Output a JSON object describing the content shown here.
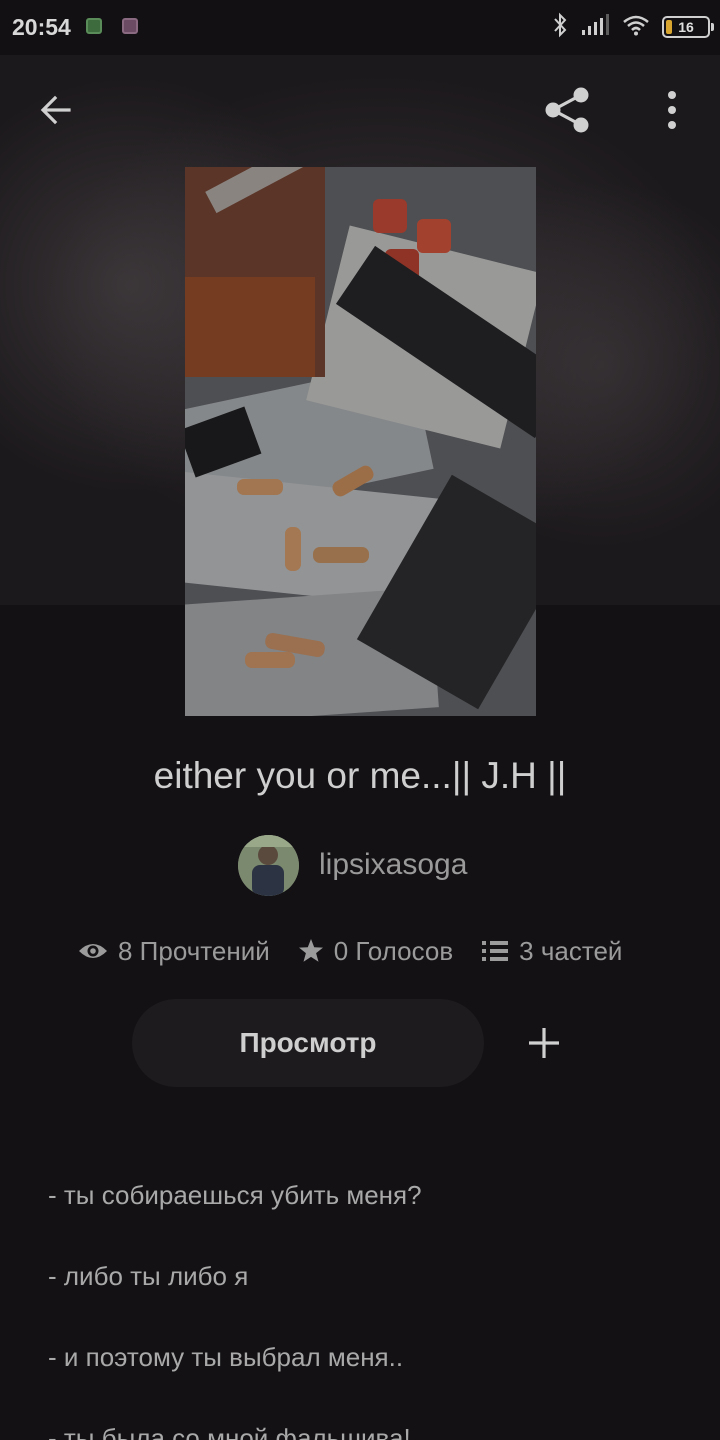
{
  "status_bar": {
    "time": "20:54",
    "battery": "16",
    "icons": [
      "notification-green-icon",
      "notification-purple-icon",
      "bluetooth-icon",
      "signal-icon",
      "wifi-icon",
      "battery-icon"
    ]
  },
  "toolbar": {
    "back_icon": "arrow-left-icon",
    "share_icon": "share-icon",
    "more_icon": "more-vertical-icon"
  },
  "story": {
    "title": "either you or me...|| J.H ||",
    "author": "lipsixasoga",
    "stats": {
      "reads": "8 Прочтений",
      "votes": "0 Голосов",
      "parts": "3 частей"
    },
    "read_button": "Просмотр",
    "add_icon": "plus-icon",
    "description": [
      "- ты собираешься убить меня?",
      "- либо ты либо я",
      "- и поэтому ты выбрал меня..",
      "- ты была со мной фальшива!"
    ]
  },
  "colors": {
    "background": "#131114",
    "text_primary": "#cfcfcf",
    "text_secondary": "#9b9b9b",
    "button_bg": "#1d1b1e",
    "battery_low": "#d8a62e"
  }
}
